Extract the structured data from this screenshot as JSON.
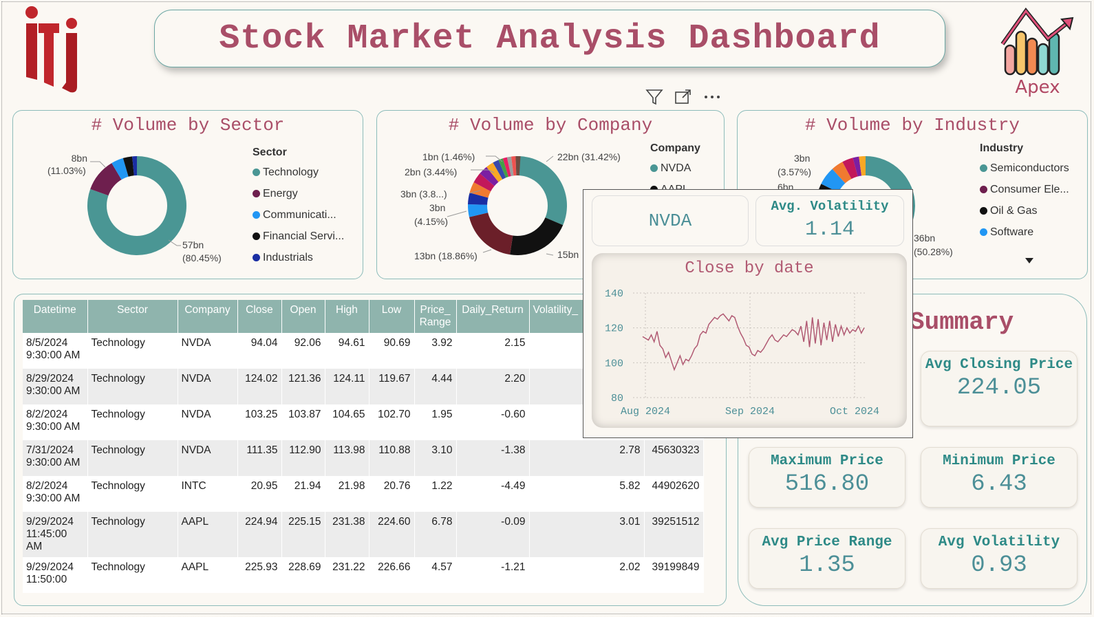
{
  "header": {
    "title": "Stock Market Analysis Dashboard",
    "apex_label": "Apex"
  },
  "icons": {
    "logo": "iti-logo",
    "apex": "apex-chart-logo",
    "filter": "filter-icon",
    "focus": "focus-mode-icon",
    "more": "more-options-icon"
  },
  "colors": {
    "title": "#a94e68",
    "teal": "#4a9694",
    "header_row": "#8fb4ad",
    "kpi_label": "#2e8a87",
    "kpi_value": "#4c8f97"
  },
  "sector_chart": {
    "title": "# Volume by Sector",
    "legend_title": "Sector",
    "legend": [
      {
        "label": "Technology",
        "color": "#4a9694"
      },
      {
        "label": "Energy",
        "color": "#6e1f4e"
      },
      {
        "label": "Communicati...",
        "color": "#2196f3"
      },
      {
        "label": "Financial Servi...",
        "color": "#111111"
      },
      {
        "label": "Industrials",
        "color": "#1a2ea3"
      }
    ],
    "labels": {
      "small_value": "8bn",
      "small_pct": "(11.03%)",
      "big_value": "57bn",
      "big_pct": "(80.45%)"
    }
  },
  "company_chart": {
    "title": "# Volume by Company",
    "legend_title": "Company",
    "legend": [
      {
        "label": "NVDA",
        "color": "#4a9694"
      },
      {
        "label": "AAPL",
        "color": "#111111"
      }
    ],
    "labels": {
      "l1": "1bn (1.46%)",
      "l2": "2bn (3.44%)",
      "l3": "3bn (3.8...)",
      "l4a": "3bn",
      "l4b": "(4.15%)",
      "l5": "13bn (18.86%)",
      "l6": "15bn",
      "l7": "22bn (31.42%)"
    }
  },
  "industry_chart": {
    "title": "# Volume by Industry",
    "legend_title": "Industry",
    "legend": [
      {
        "label": "Semiconductors",
        "color": "#4a9694"
      },
      {
        "label": "Consumer Ele...",
        "color": "#6e1f4e"
      },
      {
        "label": "Oil & Gas",
        "color": "#111111"
      },
      {
        "label": "Software",
        "color": "#2196f3"
      }
    ],
    "labels": {
      "l1a": "3bn",
      "l1b": "(3.57%)",
      "l2": "6bn",
      "l3a": "36bn",
      "l3b": "(50.28%)"
    }
  },
  "table": {
    "columns": [
      "Datetime",
      "Sector",
      "Company",
      "Close",
      "Open",
      "High",
      "Low",
      "Price_ Range",
      "Daily_Return",
      "Volatility_",
      ""
    ],
    "rows": [
      [
        "8/5/2024 9:30:00 AM",
        "Technology",
        "NVDA",
        "94.04",
        "92.06",
        "94.61",
        "90.69",
        "3.92",
        "2.15",
        "",
        ""
      ],
      [
        "8/29/2024 9:30:00 AM",
        "Technology",
        "NVDA",
        "124.02",
        "121.36",
        "124.11",
        "119.67",
        "4.44",
        "2.20",
        "",
        ""
      ],
      [
        "8/2/2024 9:30:00 AM",
        "Technology",
        "NVDA",
        "103.25",
        "103.87",
        "104.65",
        "102.70",
        "1.95",
        "-0.60",
        "",
        ""
      ],
      [
        "7/31/2024 9:30:00 AM",
        "Technology",
        "NVDA",
        "111.35",
        "112.90",
        "113.98",
        "110.88",
        "3.10",
        "-1.38",
        "2.78",
        "45630323"
      ],
      [
        "8/2/2024 9:30:00 AM",
        "Technology",
        "INTC",
        "20.95",
        "21.94",
        "21.98",
        "20.76",
        "1.22",
        "-4.49",
        "5.82",
        "44902620"
      ],
      [
        "9/29/2024 11:45:00 AM",
        "Technology",
        "AAPL",
        "224.94",
        "225.15",
        "231.38",
        "224.60",
        "6.78",
        "-0.09",
        "3.01",
        "39251512"
      ],
      [
        "9/29/2024 11:50:00",
        "Technology",
        "AAPL",
        "225.93",
        "228.69",
        "231.22",
        "226.66",
        "4.57",
        "-1.21",
        "2.02",
        "39199849"
      ]
    ]
  },
  "summary": {
    "title": "Summary",
    "kpis": [
      {
        "label": "Avg Closing Price",
        "value": "224.05"
      },
      {
        "label": "Maximum Price",
        "value": "516.80"
      },
      {
        "label": "Minimum Price",
        "value": "6.43"
      },
      {
        "label": "Avg Price Range",
        "value": "1.35"
      },
      {
        "label": "Avg Volatility",
        "value": "0.93"
      }
    ]
  },
  "tooltip": {
    "company": "NVDA",
    "volatility_label": "Avg. Volatility",
    "volatility_value": "1.14",
    "chart_title": "Close by date"
  },
  "chart_data": {
    "type": "line",
    "title": "Close by date",
    "xlabel": "",
    "ylabel": "",
    "x_ticks": [
      "Aug 2024",
      "Sep 2024",
      "Oct 2024"
    ],
    "y_ticks": [
      80,
      100,
      120,
      140
    ],
    "ylim": [
      80,
      140
    ],
    "grid": true,
    "series": [
      {
        "color": "#b15a73",
        "values": [
          115,
          114,
          113,
          116,
          112,
          118,
          110,
          108,
          103,
          106,
          101,
          96,
          100,
          104,
          99,
          102,
          101,
          104,
          108,
          110,
          116,
          118,
          117,
          122,
          124,
          126,
          125,
          127,
          128,
          126,
          124,
          127,
          126,
          121,
          117,
          114,
          110,
          109,
          105,
          104,
          107,
          106,
          108,
          111,
          114,
          116,
          113,
          112,
          114,
          116,
          115,
          117,
          119,
          118,
          116,
          121,
          112,
          124,
          109,
          126,
          111,
          125,
          110,
          123,
          113,
          124,
          112,
          122,
          115,
          121,
          116,
          120,
          117,
          119,
          118,
          121,
          117,
          120
        ]
      }
    ]
  }
}
